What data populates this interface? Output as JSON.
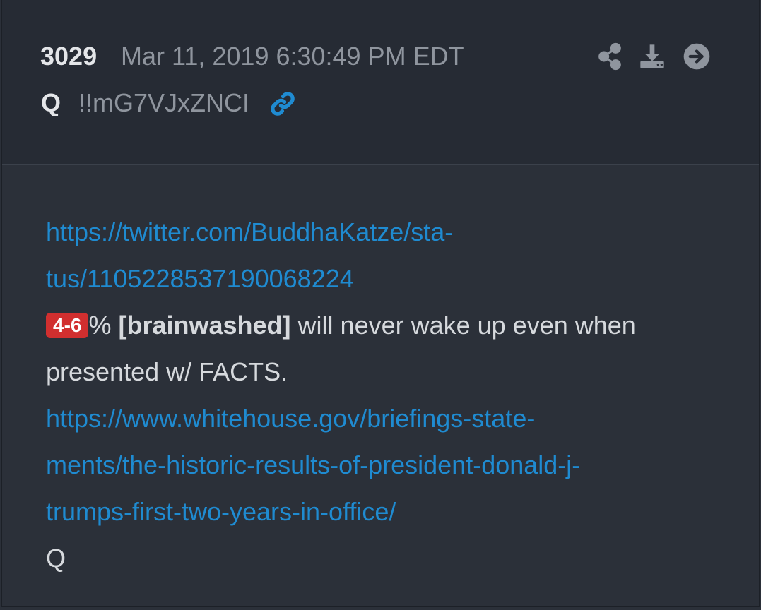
{
  "post": {
    "number": "3029",
    "date": "Mar 11, 2019 6:30:49 PM EDT",
    "author": "Q",
    "tripcode": "!!mG7VJxZNCI"
  },
  "icons": {
    "link": "link-icon",
    "share": "share-icon",
    "download": "download-icon",
    "arrow": "arrow-right-circle-icon"
  },
  "colors": {
    "link": "#1f8bd1",
    "badge": "#d12f2f",
    "header_bg": "#262b34",
    "body_bg": "#2b3039"
  },
  "content": {
    "link1_line1": "https://twitter.com/BuddhaKatze/sta-",
    "link1_line2": "tus/1105228537190068224",
    "badge": "4-6",
    "percent": "%",
    "bold_text": "[brainwashed]",
    "text_rest": " will never wake up even when",
    "text_line2": "presented w/ FACTS.",
    "link2_line1": "https://www.whitehouse.gov/briefings-state-",
    "link2_line2": "ments/the-historic-results-of-president-donald-j-",
    "link2_line3": "trumps-first-two-years-in-office/",
    "signature": "Q"
  }
}
